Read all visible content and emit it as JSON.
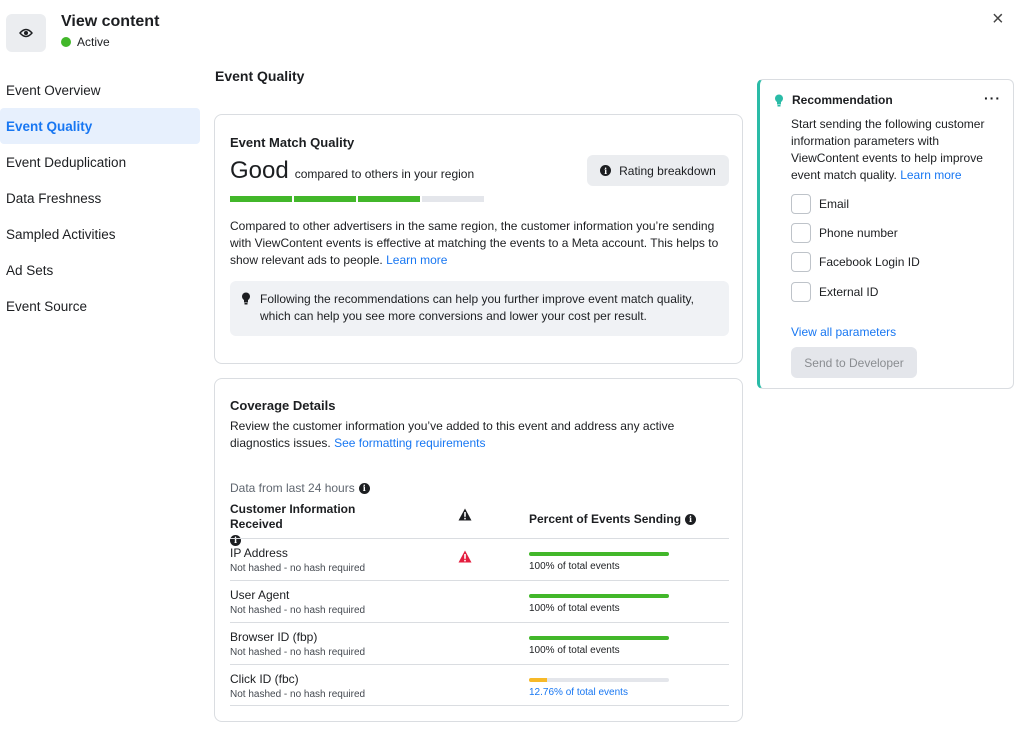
{
  "header": {
    "title": "View content",
    "status": "Active"
  },
  "sidebar": {
    "items": [
      {
        "label": "Event Overview"
      },
      {
        "label": "Event Quality"
      },
      {
        "label": "Event Deduplication"
      },
      {
        "label": "Data Freshness"
      },
      {
        "label": "Sampled Activities"
      },
      {
        "label": "Ad Sets"
      },
      {
        "label": "Event Source"
      }
    ],
    "active_index": 1
  },
  "main": {
    "section_title": "Event Quality",
    "emq": {
      "title": "Event Match Quality",
      "rating": "Good",
      "rating_sub": "compared to others in your region",
      "rating_button": "Rating breakdown",
      "segments_filled": 3,
      "segments_total": 4,
      "description": "Compared to other advertisers in the same region, the customer information you’re sending with ViewContent events is effective at matching the events to a Meta account. This helps to show relevant ads to people.",
      "learn_more": "Learn more",
      "tip": "Following the recommendations can help you further improve event match quality, which can help you see more conversions and lower your cost per result."
    },
    "coverage": {
      "title": "Coverage Details",
      "description": "Review the customer information you’ve added to this event and address any active diagnostics issues.",
      "link": "See formatting requirements",
      "data_note": "Data from last 24 hours",
      "col_left": "Customer Information Received",
      "col_right": "Percent of Events Sending",
      "rows": [
        {
          "name": "IP Address",
          "sub": "Not hashed - no hash required",
          "warning": true,
          "percent": 100,
          "percent_label": "100% of total events"
        },
        {
          "name": "User Agent",
          "sub": "Not hashed - no hash required",
          "warning": false,
          "percent": 100,
          "percent_label": "100% of total events"
        },
        {
          "name": "Browser ID (fbp)",
          "sub": "Not hashed - no hash required",
          "warning": false,
          "percent": 100,
          "percent_label": "100% of total events"
        },
        {
          "name": "Click ID (fbc)",
          "sub": "Not hashed - no hash required",
          "warning": false,
          "percent": 12.76,
          "percent_label": "12.76% of total events"
        }
      ]
    }
  },
  "recommendation": {
    "title": "Recommendation",
    "more": "···",
    "text": "Start sending the following customer information parameters with ViewContent events to help improve event match quality.",
    "learn_more": "Learn more",
    "params": [
      {
        "label": "Email"
      },
      {
        "label": "Phone number"
      },
      {
        "label": "Facebook Login ID"
      },
      {
        "label": "External ID"
      }
    ],
    "view_all": "View all parameters",
    "send_button": "Send to Developer"
  },
  "colors": {
    "accent": "#1877f2",
    "success": "#42b72a",
    "warning": "#f7b928",
    "error": "#e41e3f",
    "rec_border": "#2abba7"
  },
  "close_label": "×"
}
